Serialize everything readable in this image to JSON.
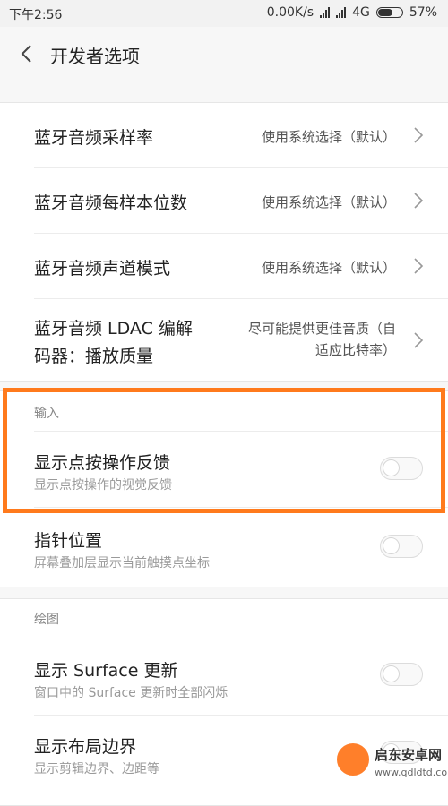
{
  "status_bar": {
    "time": "下午2:56",
    "speed": "0.00K/s",
    "network": "4G",
    "battery": "57%",
    "battery_level": 0.57
  },
  "header": {
    "title": "开发者选项"
  },
  "bluetooth_settings": [
    {
      "label": "蓝牙音频采样率",
      "value": "使用系统选择（默认）"
    },
    {
      "label": "蓝牙音频每样本位数",
      "value": "使用系统选择（默认）"
    },
    {
      "label": "蓝牙音频声道模式",
      "value": "使用系统选择（默认）"
    },
    {
      "label_line1": "蓝牙音频 LDAC 编解",
      "label_line2": "码器：播放质量",
      "value_line1": "尽可能提供更佳音质（自",
      "value_line2": "适应比特率）"
    }
  ],
  "input_section": {
    "header": "输入",
    "items": [
      {
        "label": "显示点按操作反馈",
        "sub": "显示点按操作的视觉反馈",
        "enabled": false
      },
      {
        "label": "指针位置",
        "sub": "屏幕叠加层显示当前触摸点坐标",
        "enabled": false
      }
    ]
  },
  "drawing_section": {
    "header": "绘图",
    "items": [
      {
        "label": "显示 Surface 更新",
        "sub": "窗口中的 Surface 更新时全部闪烁",
        "enabled": false
      },
      {
        "label": "显示布局边界",
        "sub": "显示剪辑边界、边距等",
        "enabled": false
      }
    ]
  },
  "watermark": {
    "title": "启东安卓网",
    "url": "www.qdldtd.com"
  },
  "colors": {
    "highlight": "#ff7a1c",
    "background": "#f7f7f7"
  }
}
